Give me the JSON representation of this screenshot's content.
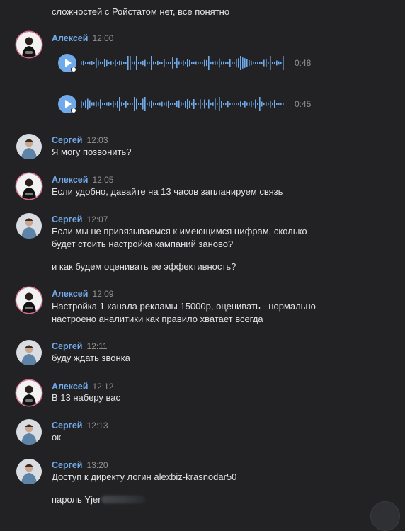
{
  "chat": {
    "prev_text": "сложностей с Ройстатом нет, все понятно",
    "messages": [
      {
        "author": "Алексей",
        "time": "12:00",
        "voice": [
          {
            "duration": "0:48"
          },
          {
            "duration": "0:45"
          }
        ]
      },
      {
        "author": "Сергей",
        "time": "12:03",
        "lines": [
          "Я могу позвонить?"
        ]
      },
      {
        "author": "Алексей",
        "time": "12:05",
        "lines": [
          "Если удобно, давайте на 13 часов запланируем связь"
        ]
      },
      {
        "author": "Сергей",
        "time": "12:07",
        "lines": [
          "Если мы не привязываемся к имеющимся цифрам, сколько",
          "будет стоить настройка кампаний заново?",
          "и как будем оценивать ее эффективность?"
        ]
      },
      {
        "author": "Алексей",
        "time": "12:09",
        "lines": [
          "Настройка 1 канала рекламы 15000р, оценивать - нормально",
          "настроено аналитики как правило хватает всегда"
        ]
      },
      {
        "author": "Сергей",
        "time": "12:11",
        "lines": [
          "буду ждать звонка"
        ]
      },
      {
        "author": "Алексей",
        "time": "12:12",
        "lines": [
          "В 13 наберу вас"
        ]
      },
      {
        "author": "Сергей",
        "time": "12:13",
        "lines": [
          "ок"
        ]
      },
      {
        "author": "Сергей",
        "time": "13:20",
        "lines": [
          "Доступ к директу логин alexbiz-krasnodar50",
          "пароль Yjer"
        ]
      }
    ]
  },
  "icons": {
    "play": "play-icon",
    "scroll_down": "scroll-down-button"
  },
  "colors": {
    "background": "#222224",
    "author_name": "#71aaeb",
    "timestamp": "#939393",
    "voice_accent": "#71aaeb"
  }
}
